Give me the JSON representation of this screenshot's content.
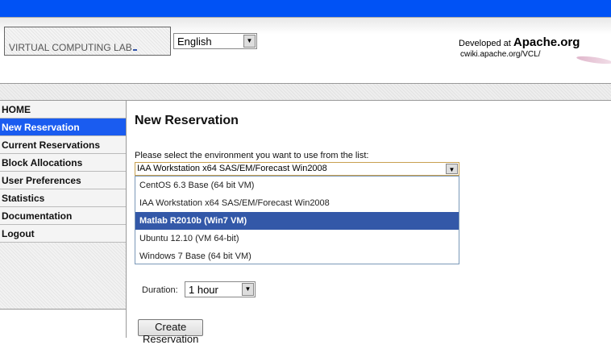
{
  "header": {
    "logo_text": "VIRTUAL COMPUTING LAB",
    "language": "English",
    "developed_at": "Developed at",
    "apache": "Apache.org",
    "url": "cwiki.apache.org/VCL/"
  },
  "sidebar": {
    "items": [
      {
        "label": "HOME"
      },
      {
        "label": "New Reservation"
      },
      {
        "label": "Current Reservations"
      },
      {
        "label": "Block Allocations"
      },
      {
        "label": "User Preferences"
      },
      {
        "label": "Statistics"
      },
      {
        "label": "Documentation"
      },
      {
        "label": "Logout"
      }
    ]
  },
  "main": {
    "title": "New Reservation",
    "prompt": "Please select the environment you want to use from the list:",
    "selected_env": "IAA Workstation x64 SAS/EM/Forecast Win2008",
    "options": [
      "CentOS 6.3 Base (64 bit VM)",
      "IAA Workstation x64 SAS/EM/Forecast Win2008",
      "Matlab R2010b (Win7 VM)",
      "Ubuntu 12.10 (VM 64-bit)",
      "Windows 7 Base (64 bit VM)"
    ],
    "duration_label": "Duration:",
    "duration": "1 hour",
    "create_button": "Create Reservation"
  },
  "colors": {
    "topbar": "#0052f5",
    "active_nav": "#1a5cf0",
    "highlight": "#3358a8"
  }
}
